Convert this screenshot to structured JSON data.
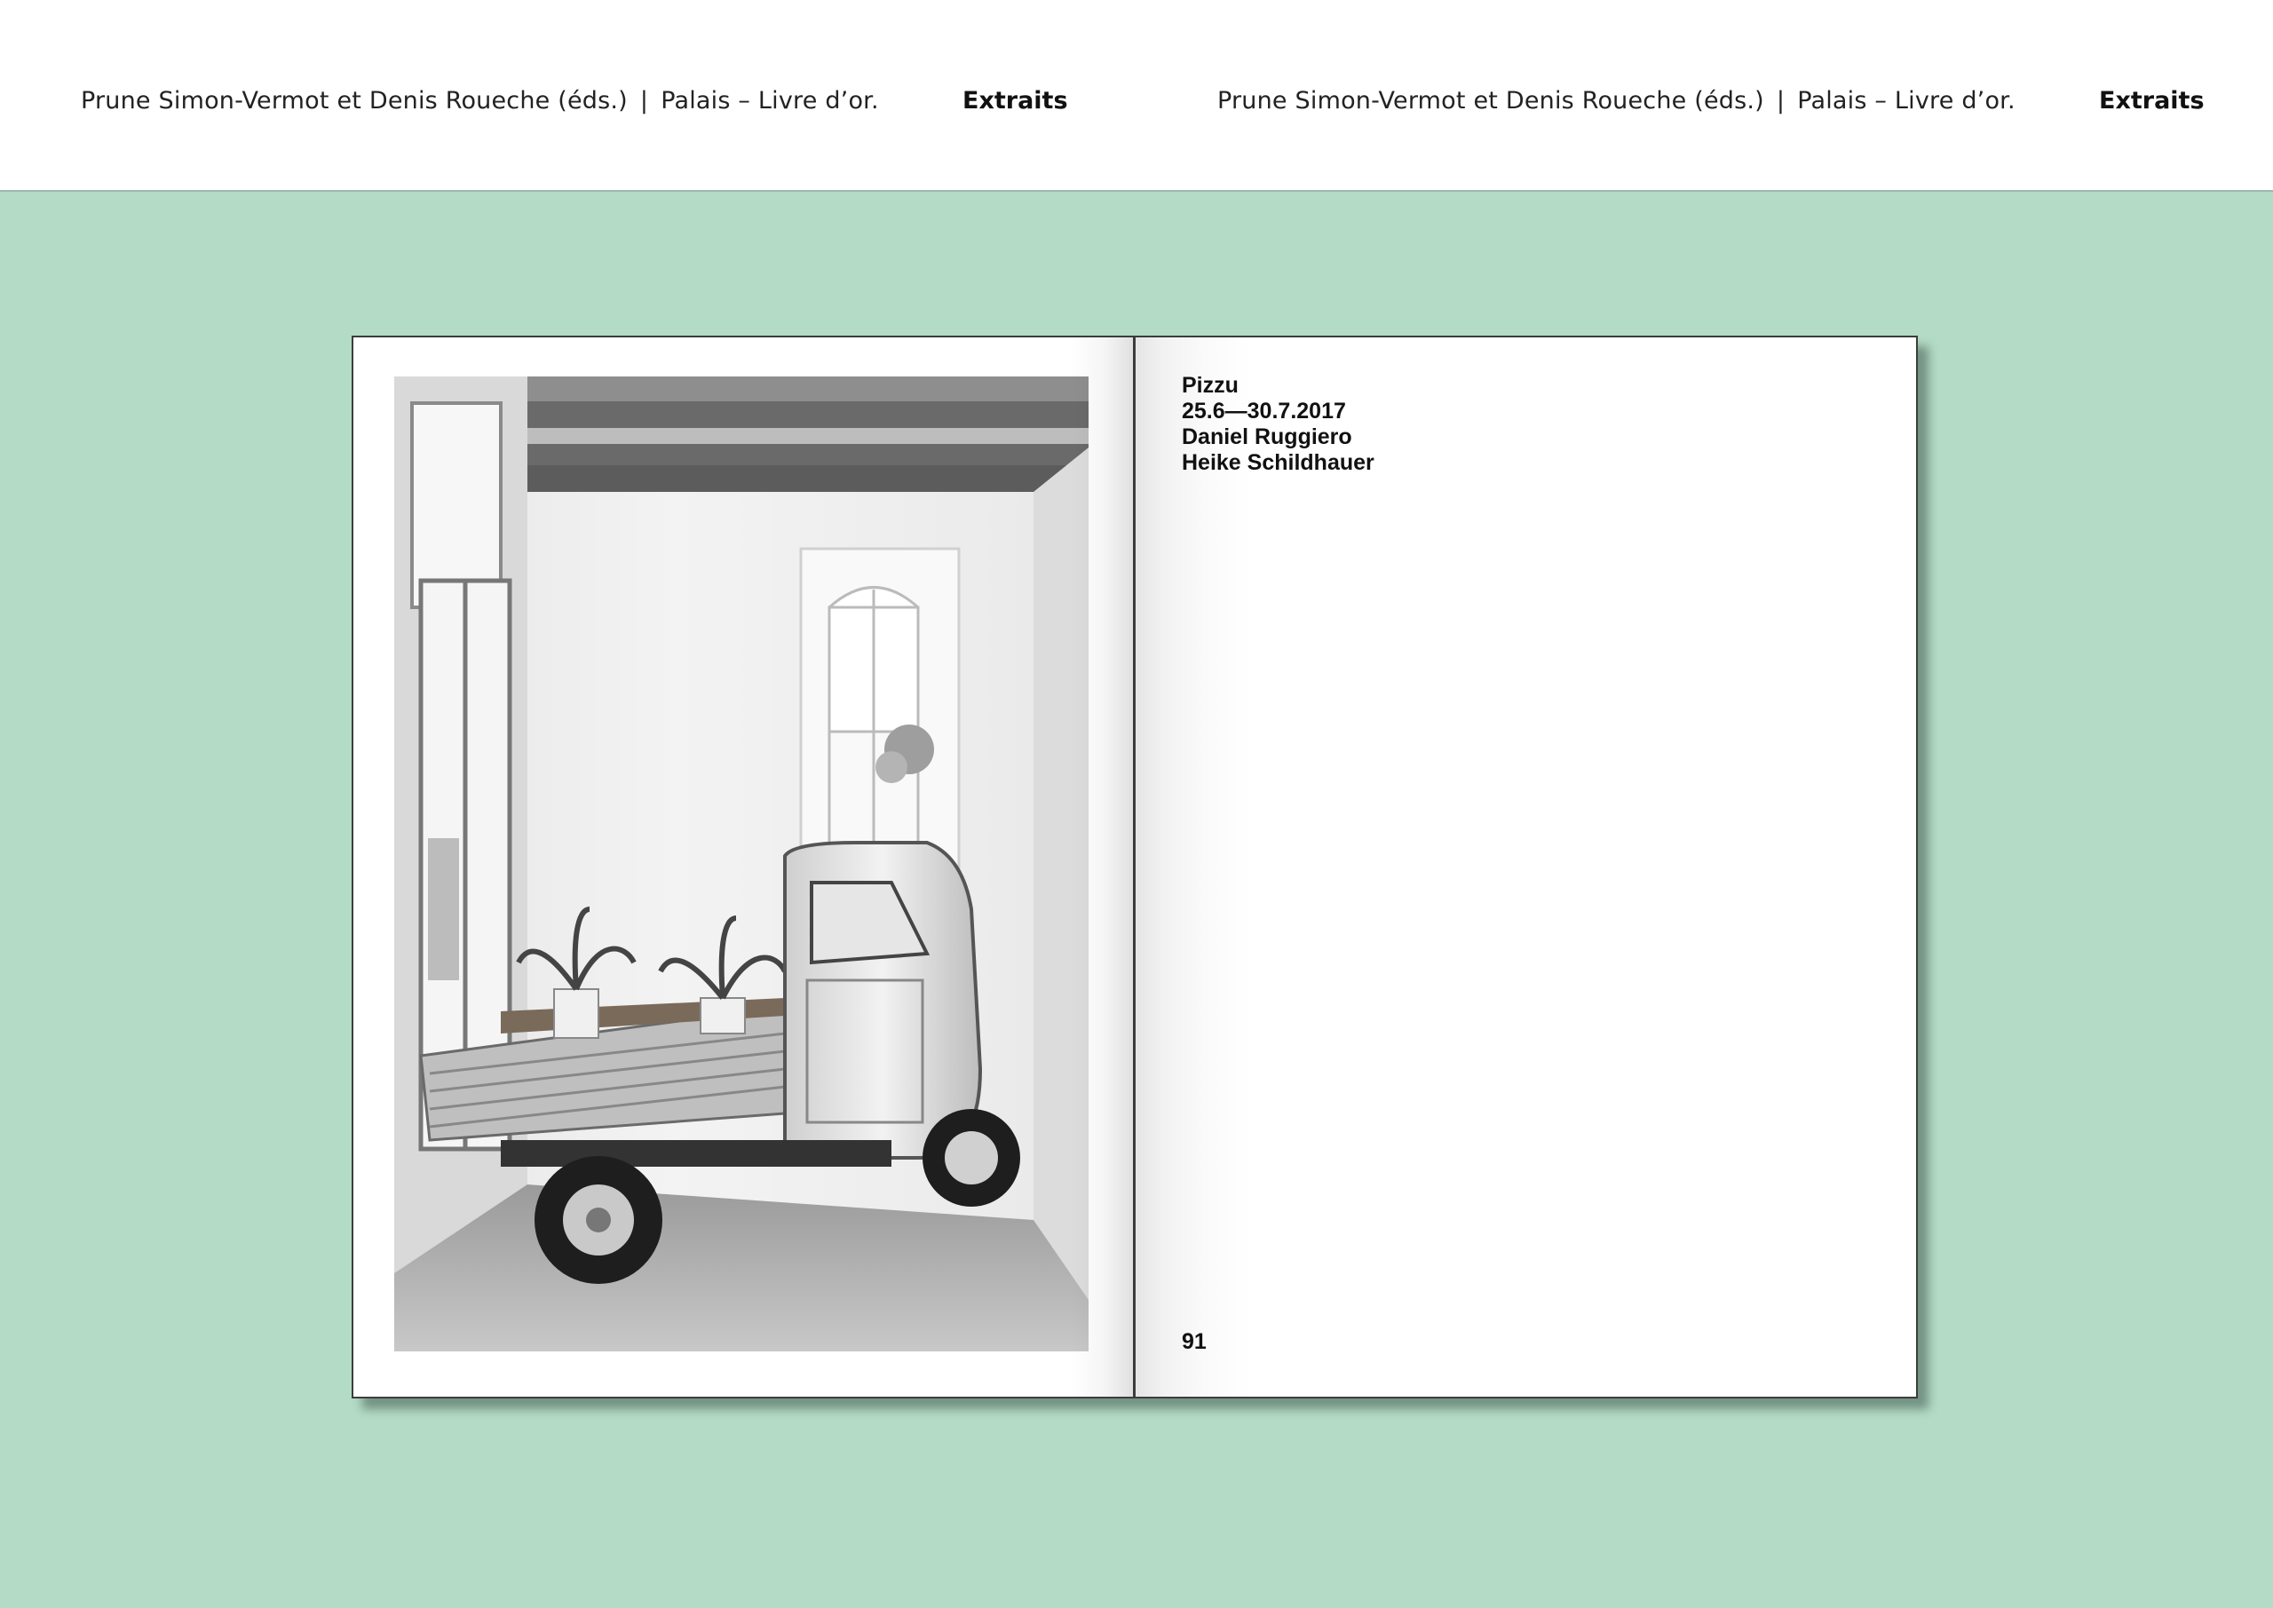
{
  "header": {
    "left": {
      "authors": "Prune Simon-Vermot et Denis Roueche (éds.)",
      "separator": "|",
      "title": "Palais – Livre d’or.",
      "section": "Extraits"
    },
    "right": {
      "authors": "Prune Simon-Vermot et Denis Roueche (éds.)",
      "separator": "|",
      "title": "Palais – Livre d’or.",
      "section": "Extraits"
    }
  },
  "colors": {
    "background": "#b3dbc6",
    "header_background": "#ffffff",
    "page_background": "#ffffff",
    "text": "#111111"
  },
  "book": {
    "left_page": {
      "image": "black-and-white-photo-three-wheeled-truck-with-lilies-in-room"
    },
    "right_page": {
      "lines": [
        "Pizzu",
        "25.6—30.7.2017",
        "Daniel Ruggiero",
        "Heike Schildhauer"
      ],
      "page_number": "91"
    }
  }
}
